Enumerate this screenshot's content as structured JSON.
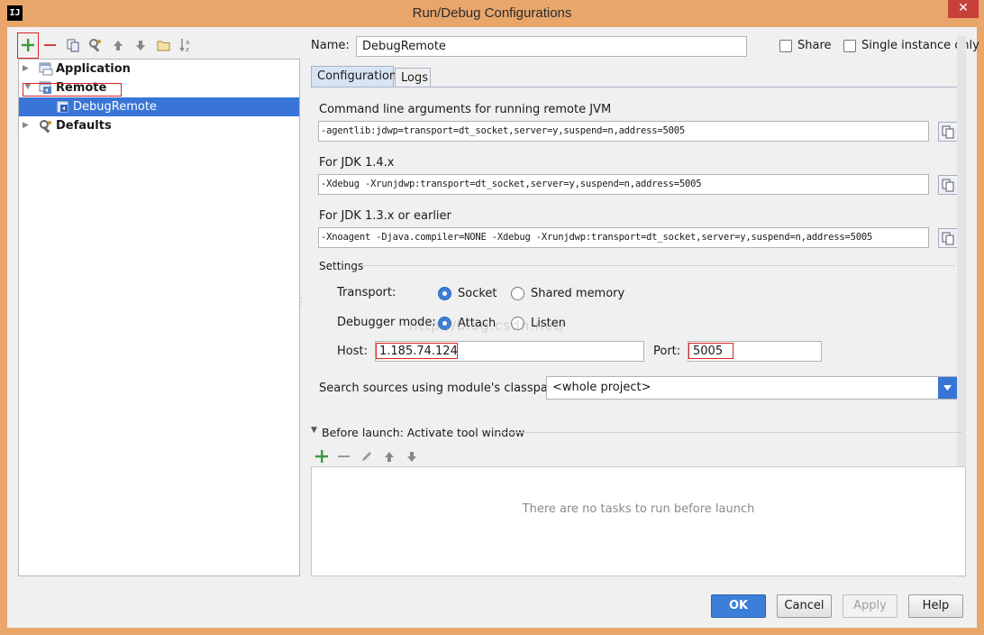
{
  "window": {
    "title": "Run/Debug Configurations",
    "app_icon_text": "IJ",
    "close_glyph": "✕"
  },
  "left_toolbar": {
    "icons": [
      "add-icon",
      "remove-icon",
      "copy-icon",
      "settings-wrench-icon",
      "move-up-icon",
      "move-down-icon",
      "folder-icon",
      "sort-az-icon"
    ]
  },
  "tree": {
    "items": [
      {
        "label": "Application",
        "icon": "application-config-icon"
      },
      {
        "label": "Remote",
        "icon": "remote-config-icon"
      },
      {
        "label": "DebugRemote",
        "icon": "remote-debug-icon"
      },
      {
        "label": "Defaults",
        "icon": "defaults-wrench-icon"
      }
    ]
  },
  "form": {
    "name_label": "Name:",
    "name_value": "DebugRemote",
    "share_label": "Share",
    "single_instance_label": "Single instance only",
    "tabs": [
      {
        "label": "Configuration",
        "active": true
      },
      {
        "label": "Logs",
        "active": false
      }
    ],
    "cmd_args_label": "Command line arguments for running remote JVM",
    "cmd_args_value": "-agentlib:jdwp=transport=dt_socket,server=y,suspend=n,address=5005",
    "jdk14_label": "For JDK 1.4.x",
    "jdk14_value": "-Xdebug -Xrunjdwp:transport=dt_socket,server=y,suspend=n,address=5005",
    "jdk13_label": "For JDK 1.3.x or earlier",
    "jdk13_value": "-Xnoagent -Djava.compiler=NONE -Xdebug -Xrunjdwp:transport=dt_socket,server=y,suspend=n,address=5005",
    "settings_label": "Settings",
    "transport_label": "Transport:",
    "transport_options": [
      "Socket",
      "Shared memory"
    ],
    "transport_selected": "Socket",
    "debugger_mode_label": "Debugger mode:",
    "debugger_mode_options": [
      "Attach",
      "Listen"
    ],
    "debugger_mode_selected": "Attach",
    "host_label": "Host:",
    "host_value": "1.185.74.124",
    "port_label": "Port:",
    "port_value": "5005",
    "classpath_label": "Search sources using module's classpath:",
    "classpath_value": "<whole project>"
  },
  "before_launch": {
    "title": "Before launch: Activate tool window",
    "empty_text": "There are no tasks to run before launch",
    "icons": [
      "add-icon",
      "remove-icon",
      "edit-pencil-icon",
      "move-up-icon",
      "move-down-icon"
    ]
  },
  "buttons": {
    "ok": "OK",
    "cancel": "Cancel",
    "apply": "Apply",
    "help": "Help"
  },
  "watermark": "http://blog.csdn.net/",
  "colors": {
    "window_frame": "#e8a66b",
    "selection": "#3875d7",
    "highlight_outline": "#dd2222",
    "primary_button": "#3b7fd9"
  }
}
